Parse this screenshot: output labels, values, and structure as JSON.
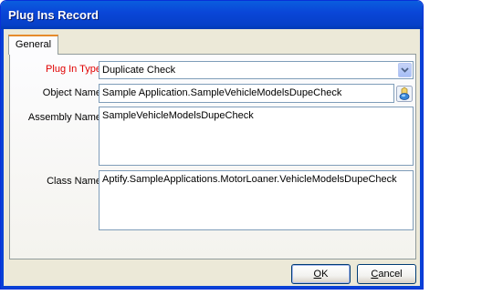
{
  "window": {
    "title": "Plug Ins Record"
  },
  "tabs": [
    {
      "label": "General"
    }
  ],
  "form": {
    "plugin_type": {
      "label": "Plug In Type",
      "value": "Duplicate Check"
    },
    "object_name": {
      "label": "Object Name",
      "value": "Sample  Application.SampleVehicleModelsDupeCheck"
    },
    "assembly_name": {
      "label": "Assembly Name",
      "value": "SampleVehicleModelsDupeCheck"
    },
    "class_name": {
      "label": "Class Name",
      "value": "Aptify.SampleApplications.MotorLoaner.VehicleModelsDupeCheck"
    }
  },
  "buttons": {
    "ok": {
      "mnemonic": "O",
      "rest": "K"
    },
    "cancel": {
      "mnemonic": "C",
      "rest": "ancel"
    }
  },
  "icons": {
    "combo": "chevron-down-icon",
    "lookup": "object-lookup-icon"
  },
  "colors": {
    "required_label": "#e00000",
    "titlebar": "#0a46d8",
    "window_bg": "#ece9d8"
  }
}
